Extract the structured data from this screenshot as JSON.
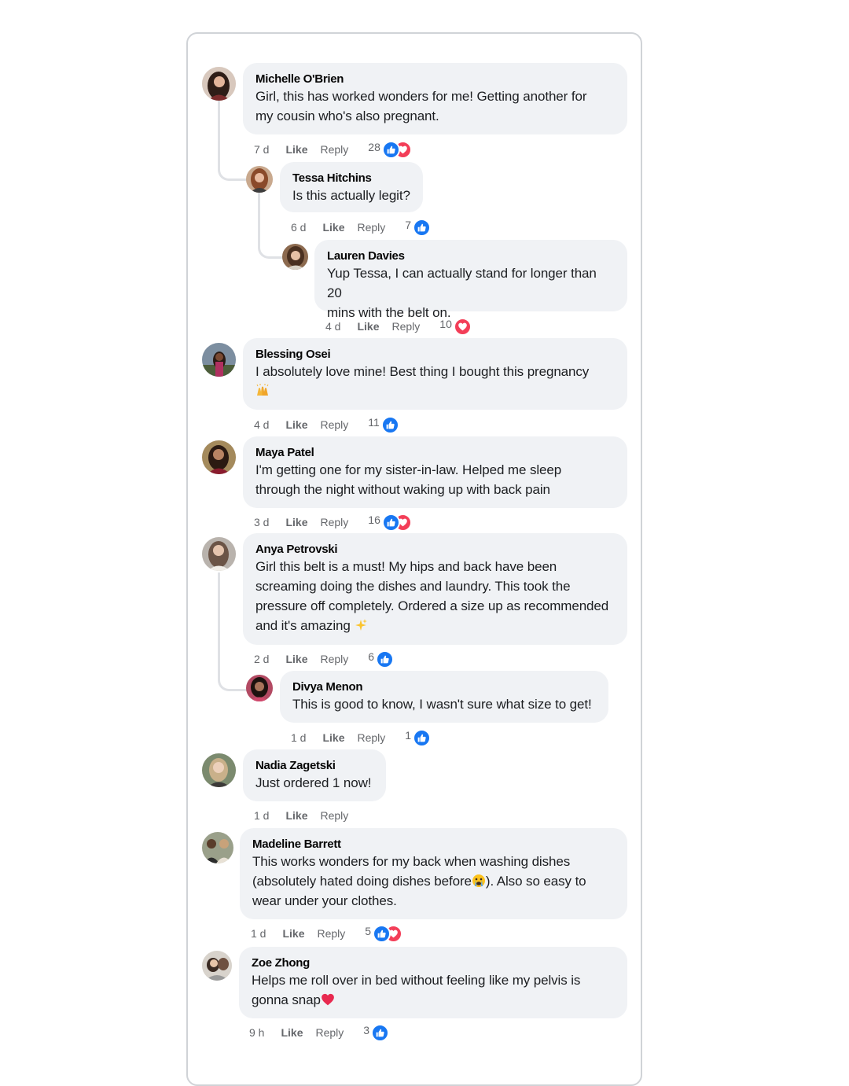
{
  "labels": {
    "like": "Like",
    "reply": "Reply"
  },
  "colors": {
    "like_blue": "#1877f2",
    "love_red": "#f33e58",
    "bubble_bg": "#f0f2f5"
  },
  "comments": [
    {
      "author": "Michelle O'Brien",
      "lines": [
        "Girl, this has worked wonders for me! Getting another for",
        "my cousin who's also pregnant."
      ],
      "time": "7 d",
      "reaction_count": "28",
      "reactions": [
        "like",
        "love"
      ]
    },
    {
      "author": "Tessa Hitchins",
      "lines": [
        "Is this actually legit?"
      ],
      "time": "6 d",
      "reaction_count": "7",
      "reactions": [
        "like"
      ]
    },
    {
      "author": "Lauren Davies",
      "lines": [
        "Yup Tessa, I can actually stand for longer than 20",
        "mins with the belt on."
      ],
      "time": "4 d",
      "reaction_count": "10",
      "reactions": [
        "love"
      ]
    },
    {
      "author": "Blessing Osei",
      "lines": [
        "I absolutely love mine! Best thing I bought this pregnancy",
        ""
      ],
      "emoji": "raising-hands-emoji",
      "time": "4 d",
      "reaction_count": "11",
      "reactions": [
        "like"
      ]
    },
    {
      "author": "Maya Patel",
      "lines": [
        "I'm getting one for my sister-in-law. Helped me sleep",
        "through the night without waking up with back pain"
      ],
      "time": "3 d",
      "reaction_count": "16",
      "reactions": [
        "like",
        "love"
      ]
    },
    {
      "author": "Anya Petrovski",
      "lines": [
        "Girl this belt is a must! My hips and back have been",
        "screaming doing the dishes and laundry. This took the",
        "pressure off completely. Ordered a size up as recommended",
        "and it's amazing"
      ],
      "emoji": "sparkles-emoji",
      "time": "2 d",
      "reaction_count": "6",
      "reactions": [
        "like"
      ]
    },
    {
      "author": "Divya Menon",
      "lines": [
        "This is good to know, I wasn't sure what size to get!"
      ],
      "time": "1 d",
      "reaction_count": "1",
      "reactions": [
        "like"
      ]
    },
    {
      "author": "Nadia Zagetski",
      "lines": [
        "Just ordered 1 now!"
      ],
      "time": "1 d",
      "reaction_count": "",
      "reactions": []
    },
    {
      "author": "Madeline Barrett",
      "lines": [
        "This works wonders for my back when washing dishes",
        "(absolutely hated doing dishes before",
        "wear under your clothes."
      ],
      "line2_tail": "). Also so easy to",
      "emoji": "crying-face-emoji",
      "time": "1 d",
      "reaction_count": "5",
      "reactions": [
        "like",
        "love"
      ]
    },
    {
      "author": "Zoe Zhong",
      "lines": [
        "Helps me roll over in bed without feeling like my pelvis is",
        "gonna snap"
      ],
      "emoji": "heart-emoji",
      "time": "9 h",
      "reaction_count": "3",
      "reactions": [
        "like"
      ]
    }
  ]
}
